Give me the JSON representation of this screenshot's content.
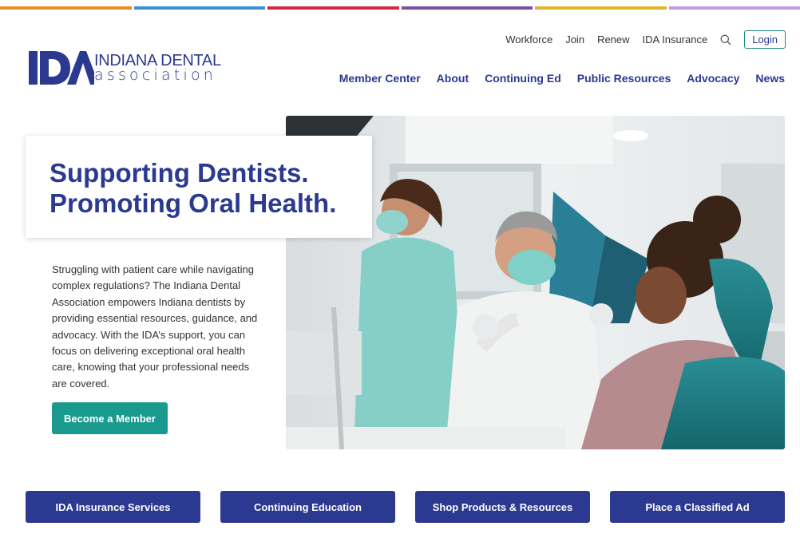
{
  "colors": {
    "brand_navy": "#2b3990",
    "brand_teal": "#1a9a8e",
    "strip": [
      "#f08a24",
      "#3d8fd1",
      "#d7263d",
      "#7b4fa0",
      "#e0b42b",
      "#c19be0"
    ]
  },
  "logo": {
    "mark": "IDA",
    "line1": "INDIANA DENTAL",
    "line2": "association"
  },
  "utility_nav": {
    "items": [
      "Workforce",
      "Join",
      "Renew",
      "IDA Insurance"
    ],
    "search_icon": "search-icon",
    "login_label": "Login"
  },
  "main_nav": {
    "items": [
      "Member Center",
      "About",
      "Continuing Ed",
      "Public Resources",
      "Advocacy",
      "News"
    ]
  },
  "hero": {
    "headline_line1": "Supporting Dentists.",
    "headline_line2": "Promoting Oral Health.",
    "intro": "Struggling with patient care while navigating complex regulations? The Indiana Dental Association empowers Indiana dentists by providing essential resources, guidance, and advocacy. With the IDA’s support, you can focus on delivering exceptional oral health care, knowing that your professional needs are covered.",
    "cta_label": "Become a Member"
  },
  "quick_links": [
    "IDA Insurance Services",
    "Continuing Education",
    "Shop Products & Resources",
    "Place a Classified Ad"
  ]
}
